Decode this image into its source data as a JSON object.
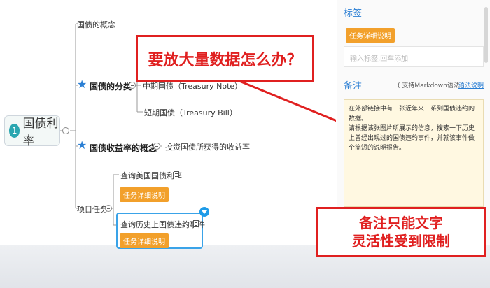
{
  "mindmap": {
    "root": {
      "number": "1",
      "label": "国债利率"
    },
    "concept": "国债的概念",
    "classification": {
      "label": "国债的分类",
      "children": [
        "中期国债（Treasury Note）",
        "短期国债（Treasury Bill）"
      ]
    },
    "yield_concept": {
      "label": "国债收益率的概念",
      "description": "投资国债所获得的收益率"
    },
    "project_tasks": {
      "label": "项目任务",
      "items": [
        {
          "label": "查询美国国债利率",
          "tag": "任务详细说明"
        },
        {
          "label": "查询历史上国债违约事件",
          "tag": "任务详细说明"
        }
      ]
    }
  },
  "panel": {
    "tags_title": "标签",
    "tag_chip": "任务详细说明",
    "tags_placeholder": "输入标签,回车添加",
    "notes_title": "备注",
    "markdown_hint": "( 支持Markdown语法 )",
    "syntax_link": "语法说明",
    "note_lines": [
      "在外部链接中有一张近年来一系列国债违约的数据。",
      "请根据该张图片所展示的信息，搜索一下历史上曾经出现过的国债违约事件，并就该事件做个简短的说明报告。"
    ]
  },
  "callouts": {
    "top": "要放大量数据怎么办？",
    "bottom_line1": "备注只能文字",
    "bottom_line2": "灵活性受到限制"
  },
  "colors": {
    "accent_blue": "#2b7fd4",
    "tag_orange": "#f2a02b",
    "callout_red": "#e02020",
    "note_bg": "#fff8e1",
    "root_teal": "#2ba6b0"
  }
}
